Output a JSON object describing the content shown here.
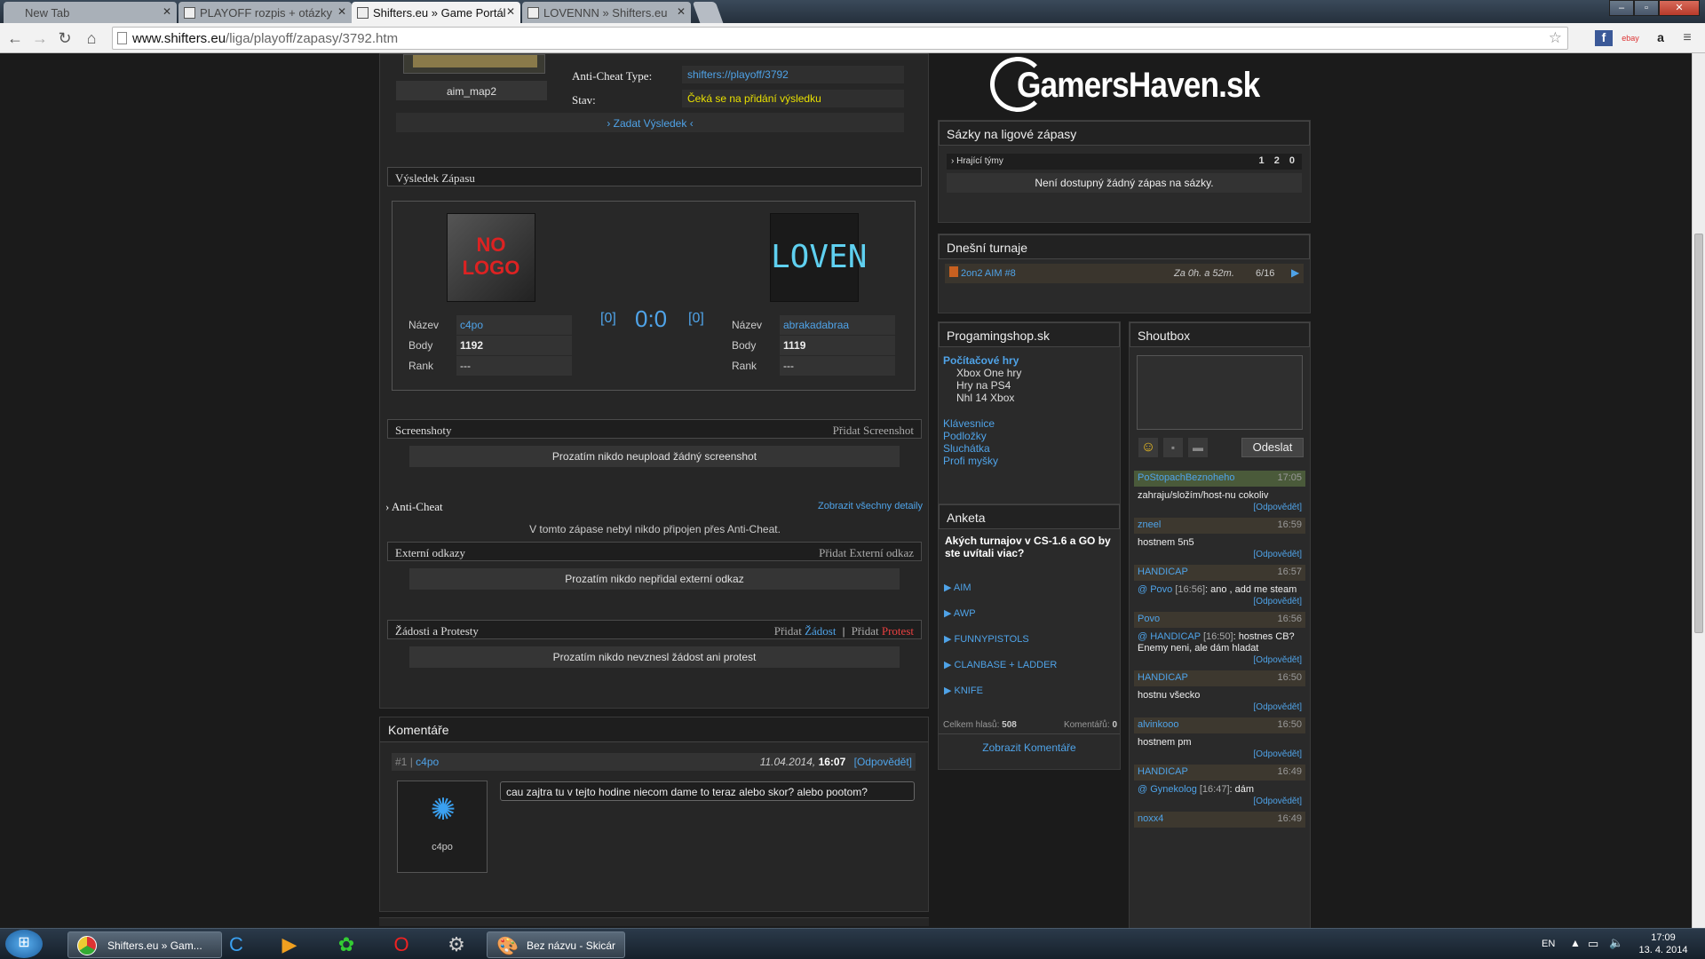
{
  "browser": {
    "tabs": [
      {
        "title": "New Tab",
        "state": "bg"
      },
      {
        "title": "PLAYOFF rozpis + otázky",
        "state": "bg"
      },
      {
        "title": "Shifters.eu » Game Portál",
        "state": "active"
      },
      {
        "title": "LOVENNN » Shifters.eu",
        "state": "bg"
      }
    ],
    "url_host": "www.shifters.eu",
    "url_path": "/liga/playoff/zapasy/3792.htm"
  },
  "match": {
    "map": "aim_map2",
    "anticheat_label": "Anti-Cheat Type:",
    "anticheat_value": "shifters://playoff/3792",
    "state_label": "Stav:",
    "state_value": "Čeká se na přidání výsledku",
    "submit_link": "› Zadat Výsledek ‹"
  },
  "result": {
    "header": "Výsledek Zápasu",
    "score": "0:0",
    "left_bracket": "[0]",
    "right_bracket": "[0]",
    "team1": {
      "logo_text_top": "NO",
      "logo_text_bottom": "LOGO",
      "name_label": "Název",
      "name": "c4po",
      "points_label": "Body",
      "points": "1192",
      "rank_label": "Rank",
      "rank": "---"
    },
    "team2": {
      "logo_text": "LOVEN",
      "name_label": "Název",
      "name": "abrakadabraa",
      "points_label": "Body",
      "points": "1119",
      "rank_label": "Rank",
      "rank": "---"
    }
  },
  "screenshots": {
    "header": "Screenshoty",
    "action": "Přidat Screenshot",
    "empty": "Prozatím nikdo neupload žádný screenshot"
  },
  "anticheat": {
    "header": "› Anti-Cheat",
    "action": "Zobrazit všechny detaily",
    "empty": "V tomto zápase nebyl nikdo připojen přes Anti-Cheat."
  },
  "links": {
    "header": "Externí odkazy",
    "action": "Přidat Externí odkaz",
    "empty": "Prozatím nikdo nepřidal externí odkaz"
  },
  "protests": {
    "header": "Žádosti a Protesty",
    "add1": "Přidat",
    "req": "Žádost",
    "sep": "|",
    "add2": "Přidat",
    "protest": "Protest",
    "empty": "Prozatím nikdo nevznesl žádost ani protest"
  },
  "comments": {
    "header": "Komentáře",
    "items": [
      {
        "num": "#1",
        "sep": "|",
        "user": "c4po",
        "date": "11.04.2014,",
        "time": "16:07",
        "reply": "[Odpovědět]",
        "text": "cau zajtra tu v tejto hodine niecom dame to teraz alebo skor? alebo pootom?",
        "avatar_name": "c4po"
      }
    ]
  },
  "sidebar": {
    "logo": "GamersHaven.sk",
    "bets": {
      "header": "Sázky na ligové zápasy",
      "col": "› Hrající týmy",
      "h1": "1",
      "h2": "2",
      "h0": "0",
      "empty": "Není dostupný žádný zápas na sázky."
    },
    "tournaments": {
      "header": "Dnešní turnaje",
      "name": "2on2 AIM #8",
      "time": "Za 0h. a 52m.",
      "slots": "6/16"
    },
    "shop": {
      "header": "Progamingshop.sk",
      "cat": "Počítačové hry",
      "sub": [
        "Xbox One hry",
        "Hry na PS4",
        "Nhl 14 Xbox"
      ],
      "links": [
        "Klávesnice",
        "Podložky",
        "Sluchátka",
        "Profi myšky"
      ]
    },
    "poll": {
      "header": "Anketa",
      "question": "Akých turnajov v CS-1.6 a GO by ste uvítali viac?",
      "options": [
        "AIM",
        "AWP",
        "FUNNYPISTOLS",
        "CLANBASE + LADDER",
        "KNIFE"
      ],
      "votes_label": "Celkem hlasů:",
      "votes": "508",
      "comments_label": "Komentářů:",
      "comments": "0",
      "show": "Zobrazit Komentáře"
    },
    "shoutbox": {
      "header": "Shoutbox",
      "send": "Odeslat",
      "reply": "[Odpovědět]",
      "messages": [
        {
          "user": "PoStopachBeznoheho",
          "time": "17:05",
          "text": "zahraju/složím/host-nu cokoliv",
          "mention": "",
          "mtime": ""
        },
        {
          "user": "zneel",
          "time": "16:59",
          "text": "hostnem 5n5",
          "mention": "",
          "mtime": ""
        },
        {
          "user": "HANDICAP",
          "time": "16:57",
          "text": ": ano , add me steam",
          "mention": "@ Povo",
          "mtime": "[16:56]"
        },
        {
          "user": "Povo",
          "time": "16:56",
          "text": ": hostnes CB? Enemy neni, ale dám hladat",
          "mention": "@ HANDICAP",
          "mtime": "[16:50]"
        },
        {
          "user": "HANDICAP",
          "time": "16:50",
          "text": "hostnu všecko",
          "mention": "",
          "mtime": ""
        },
        {
          "user": "alvinkooo",
          "time": "16:50",
          "text": "hostnem pm",
          "mention": "",
          "mtime": ""
        },
        {
          "user": "HANDICAP",
          "time": "16:49",
          "text": ": dám",
          "mention": "@ Gynekolog",
          "mtime": "[16:47]"
        },
        {
          "user": "noxx4",
          "time": "16:49",
          "text": "",
          "mention": "",
          "mtime": ""
        }
      ]
    }
  },
  "taskbar": {
    "chrome_label": "Shifters.eu » Gam...",
    "paint_label": "Bez názvu - Skicár",
    "lang": "EN",
    "time": "17:09",
    "date": "13. 4. 2014"
  }
}
